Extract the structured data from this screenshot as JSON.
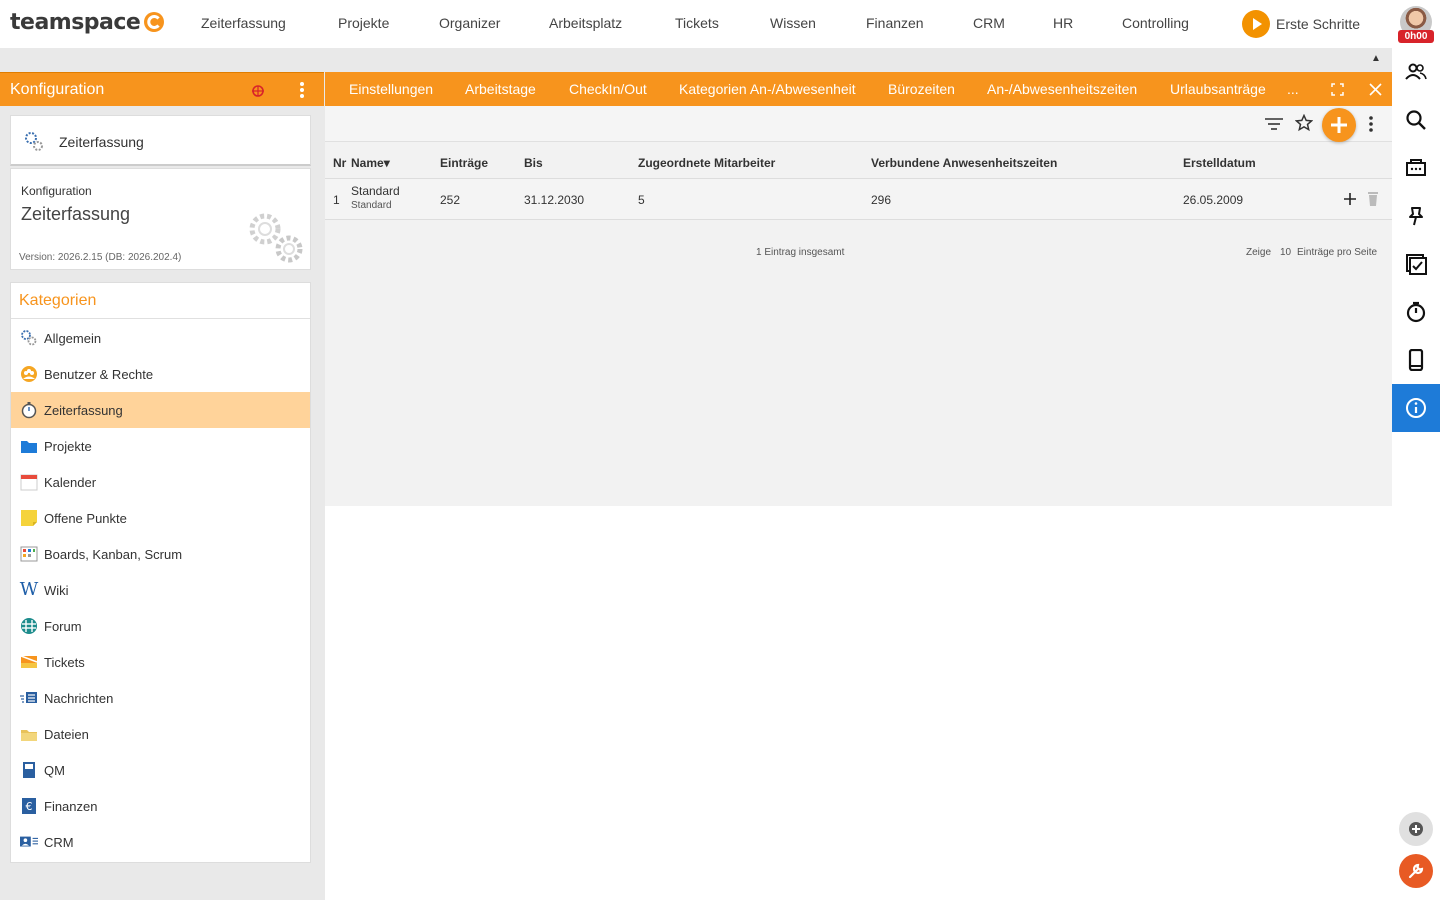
{
  "brand": {
    "name": "teamspace",
    "accent": "#f7941d",
    "active_blue": "#1e7bd8"
  },
  "nav": {
    "items": [
      "Zeiterfassung",
      "Projekte",
      "Organizer",
      "Arbeitsplatz",
      "Tickets",
      "Wissen",
      "Finanzen",
      "CRM",
      "HR",
      "Controlling"
    ],
    "erste_schritte": "Erste Schritte",
    "timer": "0h00"
  },
  "left_panel": {
    "title": "Konfiguration",
    "module": "Zeiterfassung",
    "info_label": "Konfiguration",
    "info_title": "Zeiterfassung",
    "version": "Version: 2026.2.15 (DB: 2026.202.4)",
    "categories_title": "Kategorien",
    "categories": [
      {
        "label": "Allgemein",
        "icon": "gears-icon"
      },
      {
        "label": "Benutzer & Rechte",
        "icon": "users-icon"
      },
      {
        "label": "Zeiterfassung",
        "icon": "stopwatch-icon",
        "active": true
      },
      {
        "label": "Projekte",
        "icon": "folder-icon"
      },
      {
        "label": "Kalender",
        "icon": "calendar-icon"
      },
      {
        "label": "Offene Punkte",
        "icon": "sticky-note-icon"
      },
      {
        "label": "Boards, Kanban, Scrum",
        "icon": "board-icon"
      },
      {
        "label": "Wiki",
        "icon": "wiki-icon"
      },
      {
        "label": "Forum",
        "icon": "forum-icon"
      },
      {
        "label": "Tickets",
        "icon": "ticket-icon"
      },
      {
        "label": "Nachrichten",
        "icon": "messages-icon"
      },
      {
        "label": "Dateien",
        "icon": "files-icon"
      },
      {
        "label": "QM",
        "icon": "qm-icon"
      },
      {
        "label": "Finanzen",
        "icon": "euro-icon"
      },
      {
        "label": "CRM",
        "icon": "crm-icon"
      }
    ]
  },
  "tabs": [
    "Einstellungen",
    "Arbeitstage",
    "CheckIn/Out",
    "Kategorien An-/Abwesenheit",
    "Bürozeiten",
    "An-/Abwesenheitszeiten",
    "Urlaubsanträge",
    "..."
  ],
  "table": {
    "columns": [
      "Nr",
      "Name",
      "Einträge",
      "Bis",
      "Zugeordnete Mitarbeiter",
      "Verbundene Anwesenheitszeiten",
      "Erstelldatum"
    ],
    "sort_marker": "▾",
    "rows": [
      {
        "nr": "1",
        "name": "Standard",
        "subname": "Standard",
        "eintraege": "252",
        "bis": "31.12.2030",
        "mitarbeiter": "5",
        "anwesenheitszeiten": "296",
        "erstelldatum": "26.05.2009"
      }
    ],
    "total": "1 Eintrag insgesamt",
    "per_page_prefix": "Zeige",
    "per_page_value": "10",
    "per_page_suffix": "Einträge pro Seite"
  }
}
